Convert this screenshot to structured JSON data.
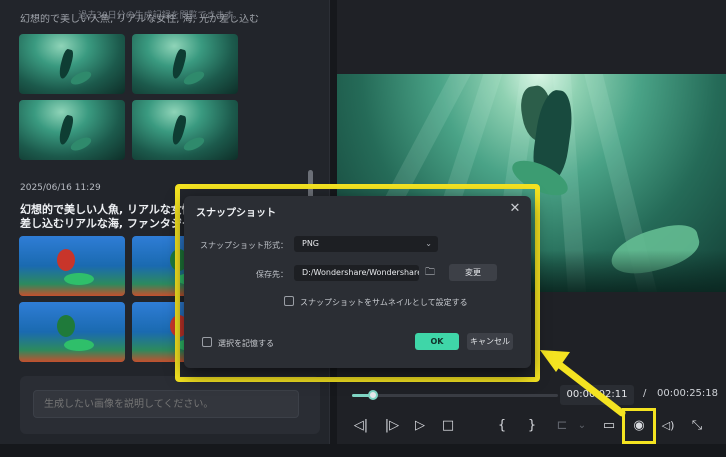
{
  "history": {
    "hint": "過去30日分の生成記録を閲覧できます。",
    "truncated_prompt": "幻想的で美しい人魚, リアルな女性, 海, 光が差し込む",
    "date": "2025/06/16 11:29",
    "prompt": "幻想的で美しい人魚, リアルな女性, リアルな海, 水中光が差し込むリアルな海, ファンタジー"
  },
  "prompt_input": {
    "placeholder": "生成したい画像を説明してください。"
  },
  "player": {
    "progress": 0.1,
    "current_time": "00:00:02:11",
    "separator": "/",
    "total_time": "00:00:25:18",
    "controls": [
      {
        "name": "prev-frame-icon",
        "glyph": "◁|"
      },
      {
        "name": "next-frame-icon",
        "glyph": "|▷"
      },
      {
        "name": "play-icon",
        "glyph": "▷"
      },
      {
        "name": "stop-icon",
        "glyph": "□"
      },
      {
        "name": "mark-in-icon",
        "glyph": "{"
      },
      {
        "name": "mark-out-icon",
        "glyph": "}"
      },
      {
        "name": "insert-icon",
        "glyph": "⊏"
      },
      {
        "name": "dropdown-chevron-icon",
        "glyph": "⌄"
      },
      {
        "name": "display-icon",
        "glyph": "▭"
      },
      {
        "name": "snapshot-camera-icon",
        "glyph": "◉"
      },
      {
        "name": "volume-icon",
        "glyph": "◁)"
      },
      {
        "name": "fullscreen-icon",
        "glyph": "⤡"
      }
    ]
  },
  "dialog": {
    "title": "スナップショット",
    "format_label": "スナップショット形式：",
    "format_value": "PNG",
    "save_label": "保存先：",
    "save_path": "D:/Wondershare/Wondershare Filmora/Output",
    "change_button": "変更",
    "thumbnail_checkbox": "スナップショットをサムネイルとして設定する",
    "remember_checkbox": "選択を記憶する",
    "ok_button": "OK",
    "cancel_button": "キャンセル"
  },
  "colors": {
    "highlight": "#f4e321",
    "accent": "#3fd6a8"
  }
}
